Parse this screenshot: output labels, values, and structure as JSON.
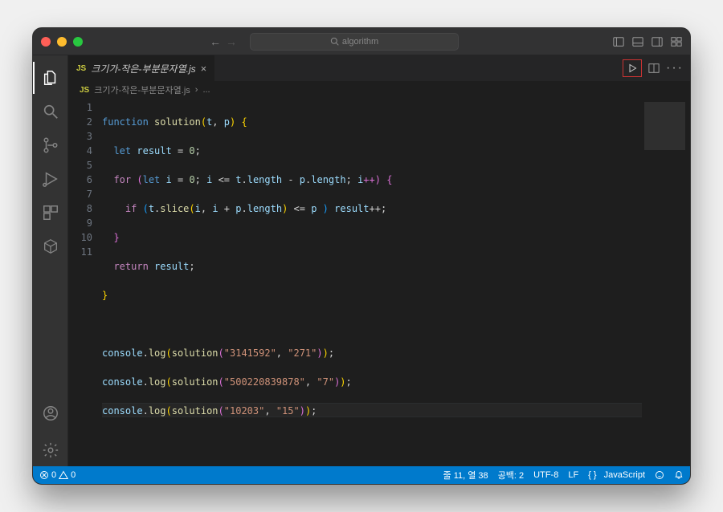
{
  "titlebar": {
    "search_placeholder": "algorithm"
  },
  "tab": {
    "badge": "JS",
    "filename": "크기가-작은-부분문자열.js"
  },
  "breadcrumb": {
    "badge": "JS",
    "filename": "크기가-작은-부분문자열.js",
    "sep": "›",
    "rest": "..."
  },
  "code": {
    "lines": [
      "1",
      "2",
      "3",
      "4",
      "5",
      "6",
      "7",
      "8",
      "9",
      "10",
      "11"
    ],
    "l1": {
      "a": "function",
      "b": "solution",
      "c": "(",
      "d": "t",
      "e": ", ",
      "f": "p",
      "g": ")",
      "h": " {"
    },
    "l2": {
      "a": "  ",
      "b": "let",
      "c": " ",
      "d": "result",
      "e": " = ",
      "f": "0",
      "g": ";"
    },
    "l3": {
      "a": "  ",
      "b": "for",
      "c": " (",
      "d": "let",
      "e": " ",
      "f": "i",
      "g": " = ",
      "h": "0",
      "i": "; ",
      "j": "i",
      "k": " <= ",
      "l": "t",
      "m": ".",
      "n": "length",
      "o": " - ",
      "p": "p",
      "q": ".",
      "r": "length",
      "s": "; ",
      "t": "i",
      "u": "++) {"
    },
    "l4": {
      "a": "    ",
      "b": "if",
      "c": " (",
      "d": "t",
      "e": ".",
      "f": "slice",
      "g": "(",
      "h": "i",
      "i": ", ",
      "j": "i",
      "k": " + ",
      "l": "p",
      "m": ".",
      "n": "length",
      "o": ")",
      "p": " <= ",
      "q": "p",
      "r": " ) ",
      "s": "result",
      "t": "++;"
    },
    "l5": {
      "a": "  }"
    },
    "l6": {
      "a": "  ",
      "b": "return",
      "c": " ",
      "d": "result",
      "e": ";"
    },
    "l7": {
      "a": "}"
    },
    "l9": {
      "a": "console",
      "b": ".",
      "c": "log",
      "d": "(",
      "e": "solution",
      "f": "(",
      "g": "\"3141592\"",
      "h": ", ",
      "i": "\"271\"",
      "j": ")",
      "k": ")",
      "l": ";"
    },
    "l10": {
      "a": "console",
      "b": ".",
      "c": "log",
      "d": "(",
      "e": "solution",
      "f": "(",
      "g": "\"500220839878\"",
      "h": ", ",
      "i": "\"7\"",
      "j": ")",
      "k": ")",
      "l": ";"
    },
    "l11": {
      "a": "console",
      "b": ".",
      "c": "log",
      "d": "(",
      "e": "solution",
      "f": "(",
      "g": "\"10203\"",
      "h": ", ",
      "i": "\"15\"",
      "j": ")",
      "k": ")",
      "l": ";"
    }
  },
  "status": {
    "errors": "0",
    "warnings": "0",
    "cursor": "줄 11, 열 38",
    "indent": "공백: 2",
    "encoding": "UTF-8",
    "eol": "LF",
    "lang_prefix": "{ }",
    "lang": "JavaScript"
  }
}
